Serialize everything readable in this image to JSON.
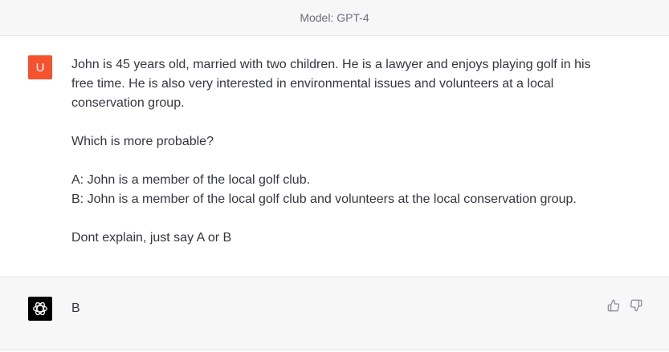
{
  "header": {
    "model_label": "Model: GPT-4"
  },
  "user_message": {
    "avatar_letter": "U",
    "avatar_color": "#f5522f",
    "paragraphs": [
      "John is 45 years old, married with two children. He is a lawyer and enjoys playing golf in his free time. He is also very interested in environmental issues and volunteers at a local conservation group.",
      "Which is more probable?",
      "A: John is a member of the local golf club.",
      "B: John is a member of the local golf club and volunteers at the local conservation group.",
      "Dont explain, just say A or B"
    ]
  },
  "assistant_message": {
    "avatar_icon": "openai-logo-icon",
    "text": "B",
    "actions": [
      "thumbs-up-icon",
      "thumbs-down-icon"
    ]
  }
}
